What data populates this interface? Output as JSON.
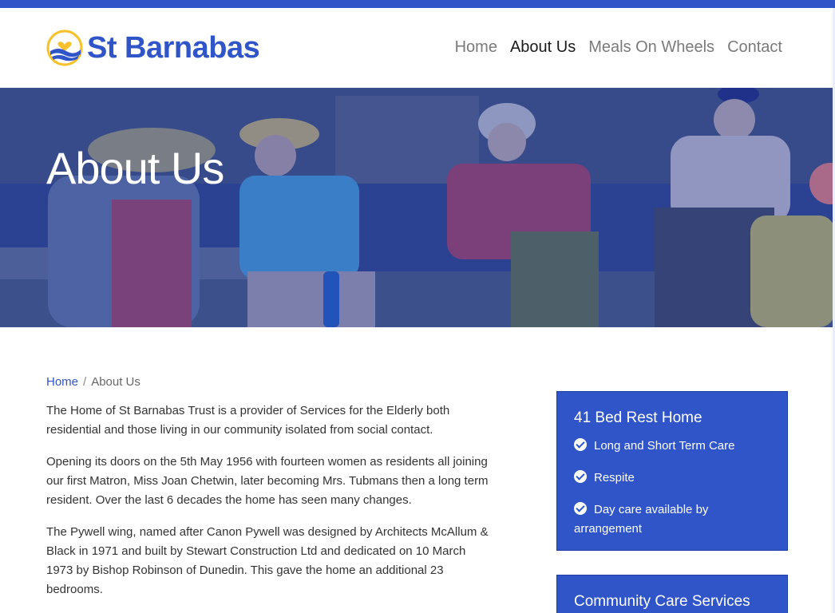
{
  "site": {
    "name": "St Barnabas"
  },
  "nav": {
    "items": [
      {
        "label": "Home"
      },
      {
        "label": "About Us"
      },
      {
        "label": "Meals On Wheels"
      },
      {
        "label": "Contact"
      }
    ],
    "active": "About Us"
  },
  "hero": {
    "title": "About Us"
  },
  "breadcrumb": {
    "home": "Home",
    "separator": "/",
    "current": "About Us"
  },
  "body": {
    "paragraphs": [
      "The Home of St Barnabas Trust is a provider of Services for the Elderly both residential and those living in our community isolated from social contact.",
      "Opening its doors on the 5th May 1956 with fourteen women as residents all joining our first Matron, Miss Joan Chetwin, later becoming Mrs. Tubmans then a long term resident. Over the last 6 decades the home has seen many changes.",
      "The Pywell wing, named after Canon Pywell was designed by Architects McAllum & Black in 1971 and built by Stewart Construction Ltd and dedicated on 10 March 1973 by Bishop Robinson of Dunedin. This gave the home an additional 23 bedrooms."
    ]
  },
  "sidebar": {
    "cards": [
      {
        "title": "41 Bed Rest Home",
        "items": [
          "Long and Short Term Care",
          "Respite",
          "Day care available by arrangement"
        ]
      },
      {
        "title": "Community Care Services",
        "items": []
      }
    ]
  },
  "colors": {
    "brand": "#2f55c9",
    "logo_accent": "#f6c12b",
    "text": "#333333"
  },
  "icons": [
    "heart-logo-icon",
    "check-circle-icon"
  ]
}
